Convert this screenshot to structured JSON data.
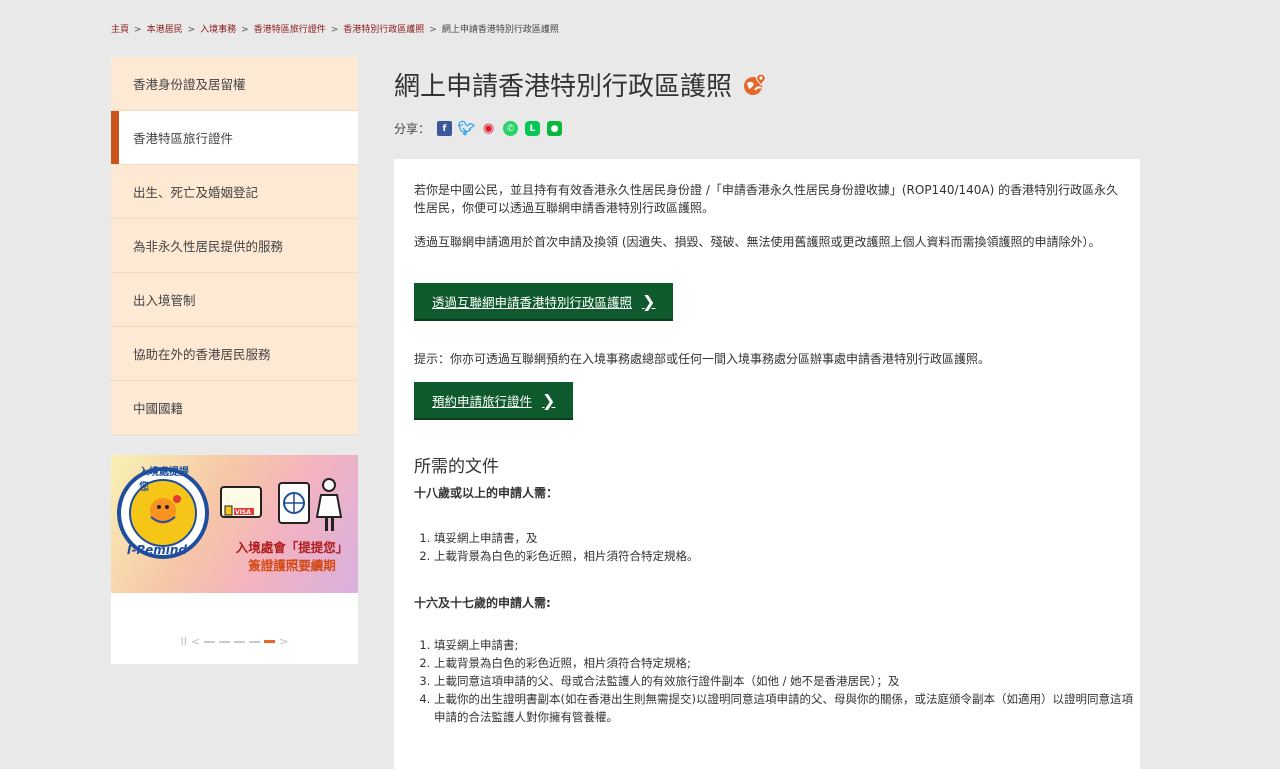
{
  "breadcrumb": [
    "主頁",
    "本港居民",
    "入境事務",
    "香港特區旅行證件",
    "香港特別行政區護照",
    "網上申請香港特別行政區護照"
  ],
  "sidebar": {
    "items": [
      {
        "label": "香港身份證及居留權"
      },
      {
        "label": "香港特區旅行證件"
      },
      {
        "label": "出生、死亡及婚姻登記"
      },
      {
        "label": "為非永久性居民提供的服務"
      },
      {
        "label": "出入境管制"
      },
      {
        "label": "協助在外的香港居民服務"
      },
      {
        "label": "中國國籍"
      }
    ],
    "active_index": 1
  },
  "banner": {
    "logo_text": "入境處提提您",
    "logo_script": "I-Remind",
    "visa_text": "VISA",
    "line1": "入境處會「提提您」",
    "line2": "簽證護照要續期"
  },
  "page": {
    "title": "網上申請香港特別行政區護照",
    "share_label": "分享："
  },
  "content": {
    "para1": "若你是中國公民，並且持有有效香港永久性居民身份證 /「申請香港永久性居民身份證收據」(ROP140/140A) 的香港特別行政區永久性居民，你便可以透過互聯網申請香港特別行政區護照。",
    "para2": "透過互聯網申請適用於首次申請及換領 (因遺失、損毀、殘破、無法使用舊護照或更改護照上個人資料而需換領護照的申請除外）。",
    "btn1": "透過互聯網申請香港特別行政區護照",
    "tip": "提示：你亦可透過互聯網預約在入境事務處總部或任何一間入境事務處分區辦事處申請香港特別行政區護照。",
    "btn2": "預約申請旅行證件",
    "docs_heading": "所需的文件",
    "adult_heading": "十八歲或以上的申請人需：",
    "adult_items": [
      "填妥網上申請書，及",
      "上載背景為白色的彩色近照，相片須符合特定規格。"
    ],
    "minor_heading": "十六及十七歲的申請人需:",
    "minor_items": [
      "填妥網上申請書;",
      "上載背景為白色的彩色近照，相片須符合特定規格;",
      "上載同意這項申請的父、母或合法監護人的有效旅行證件副本（如他 / 她不是香港居民）；及",
      "上載你的出生證明書副本(如在香港出生則無需提交)以證明同意這項申請的父、母與你的關係，或法庭頒令副本（如適用）以證明同意這項申請的合法監護人對你擁有管養權。"
    ]
  },
  "colors": {
    "sidebar_bg": "#fde9d4",
    "active_marker": "#c8551a",
    "button_bg": "#0e5a2c",
    "breadcrumb_link": "#8b1a1a"
  }
}
